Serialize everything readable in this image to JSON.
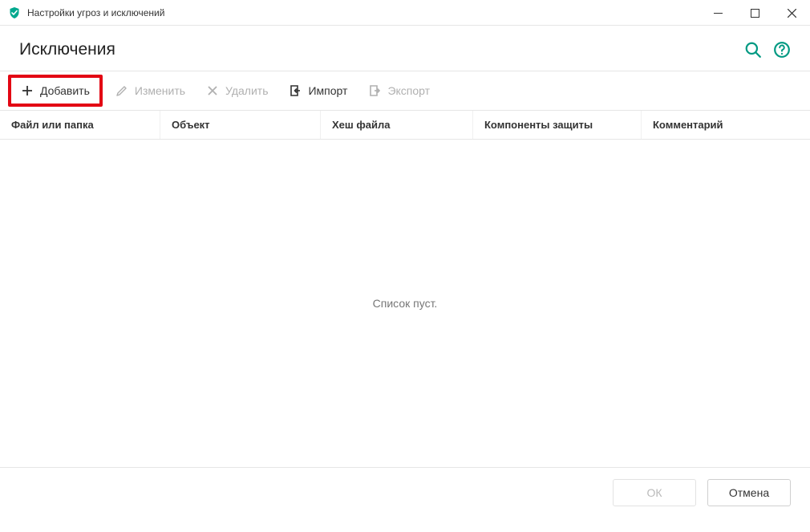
{
  "window": {
    "title": "Настройки угроз и исключений"
  },
  "header": {
    "title": "Исключения"
  },
  "toolbar": {
    "add": "Добавить",
    "edit": "Изменить",
    "delete": "Удалить",
    "import": "Импорт",
    "export": "Экспорт"
  },
  "columns": {
    "file_or_folder": "Файл или папка",
    "object": "Объект",
    "file_hash": "Хеш файла",
    "protection_components": "Компоненты защиты",
    "comment": "Комментарий"
  },
  "empty_message": "Список пуст.",
  "footer": {
    "ok": "ОК",
    "cancel": "Отмена"
  },
  "colors": {
    "accent": "#009982",
    "highlight": "#e30613"
  }
}
